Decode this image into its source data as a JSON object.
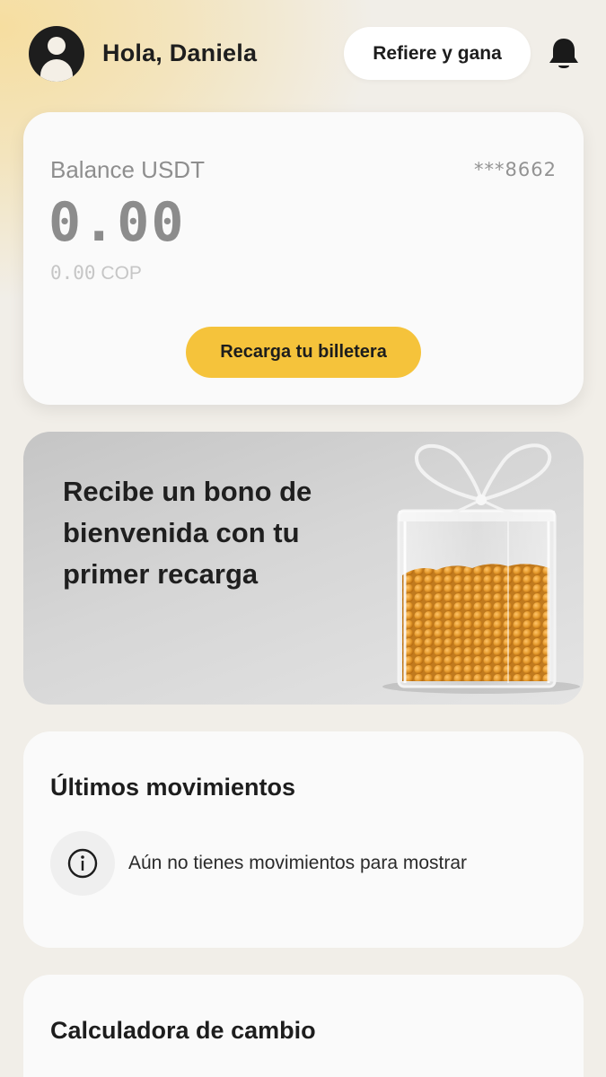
{
  "header": {
    "greeting": "Hola, Daniela",
    "refer_label": "Refiere y gana",
    "avatar_icon": "user-avatar-icon",
    "notification_icon": "bell-icon"
  },
  "balance": {
    "label": "Balance USDT",
    "account_mask": "***8662",
    "amount": "0.00",
    "cop_amount": "0.00",
    "cop_currency": "COP",
    "recharge_label": "Recarga tu billetera"
  },
  "promo": {
    "text": "Recibe un bono de bienvenida con tu primer recarga"
  },
  "movements": {
    "title": "Últimos movimientos",
    "empty_message": "Aún no tienes movimientos para mostrar",
    "info_icon": "info-icon"
  },
  "calculator": {
    "title": "Calculadora de cambio"
  },
  "colors": {
    "accent": "#f5c33b",
    "background": "#f1eee8",
    "card": "#fafafa"
  }
}
